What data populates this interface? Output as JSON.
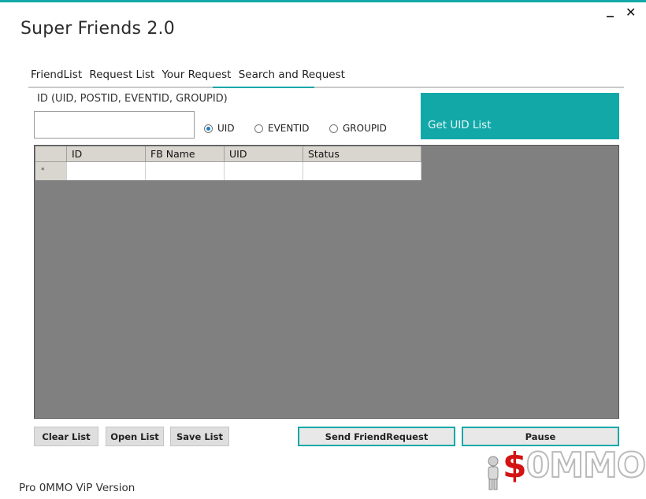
{
  "window": {
    "title": "Super Friends 2.0",
    "minimize": "_",
    "close": "✕"
  },
  "tabs": [
    "FriendList",
    "Request List",
    "Your Request",
    "Search and Request"
  ],
  "active_tab": "Search and Request",
  "search": {
    "label": "ID (UID, POSTID, EVENTID, GROUPID)",
    "input_value": "",
    "radios": [
      {
        "label": "UID",
        "checked": true
      },
      {
        "label": "EVENTID",
        "checked": false
      },
      {
        "label": "GROUPID",
        "checked": false
      }
    ],
    "get_button": "Get UID List"
  },
  "grid": {
    "columns": [
      "ID",
      "FB Name",
      "UID",
      "Status"
    ],
    "new_row_marker": "*",
    "rows": []
  },
  "buttons": {
    "clear": "Clear List",
    "open": "Open List",
    "save": "Save List",
    "send": "Send FriendRequest",
    "pause": "Pause"
  },
  "footer": "Pro 0MMO ViP Version",
  "watermark": {
    "dollar": "$",
    "text": "0MMO"
  },
  "colors": {
    "accent": "#12a8a8",
    "grid_bg": "#808080",
    "header_bg": "#d9d6cf"
  }
}
